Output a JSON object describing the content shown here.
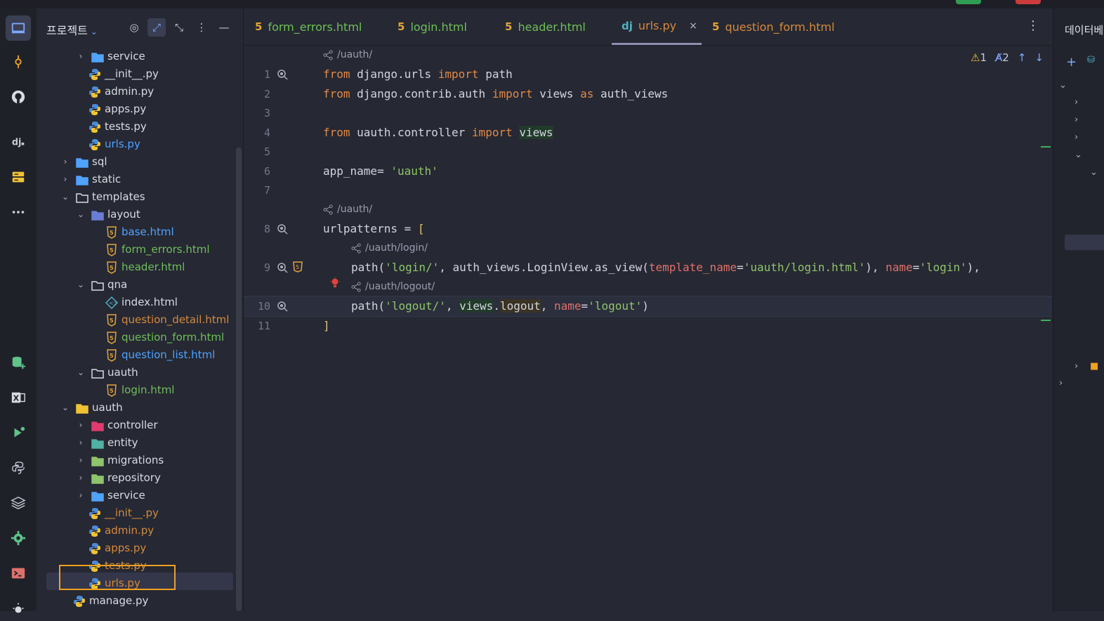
{
  "colors": {
    "accent": "#7ea9ff",
    "highlight": "#f1a020",
    "html_icon": "#e3a43a",
    "python_blue": "#4b8bd6",
    "python_yellow": "#f1c232"
  },
  "project_panel": {
    "title": "프로젝트",
    "tree": [
      {
        "label": "service",
        "type": "folder-service",
        "color": "white",
        "arrow": "›"
      },
      {
        "label": "__init__.py",
        "type": "py",
        "color": "white"
      },
      {
        "label": "admin.py",
        "type": "py",
        "color": "white"
      },
      {
        "label": "apps.py",
        "type": "py",
        "color": "white"
      },
      {
        "label": "tests.py",
        "type": "py",
        "color": "white"
      },
      {
        "label": "urls.py",
        "type": "py",
        "color": "blue"
      },
      {
        "label": "sql",
        "type": "folder-sql",
        "color": "white",
        "arrow": "›"
      },
      {
        "label": "static",
        "type": "folder-web",
        "color": "white",
        "arrow": "›"
      },
      {
        "label": "templates",
        "type": "folder-tpl",
        "color": "white",
        "arrow": "⌄"
      },
      {
        "label": "layout",
        "type": "folder-layout",
        "color": "white",
        "arrow": "⌄"
      },
      {
        "label": "base.html",
        "type": "html",
        "color": "blue"
      },
      {
        "label": "form_errors.html",
        "type": "html",
        "color": "green"
      },
      {
        "label": "header.html",
        "type": "html",
        "color": "green"
      },
      {
        "label": "qna",
        "type": "folder",
        "color": "white",
        "arrow": "⌄"
      },
      {
        "label": "index.html",
        "type": "html-alt",
        "color": "white"
      },
      {
        "label": "question_detail.html",
        "type": "html",
        "color": "orange"
      },
      {
        "label": "question_form.html",
        "type": "html",
        "color": "green"
      },
      {
        "label": "question_list.html",
        "type": "html",
        "color": "blue"
      },
      {
        "label": "uauth",
        "type": "folder",
        "color": "white",
        "arrow": "⌄"
      },
      {
        "label": "login.html",
        "type": "html",
        "color": "green"
      },
      {
        "label": "uauth",
        "type": "folder-yellow",
        "color": "white",
        "arrow": "⌄"
      },
      {
        "label": "controller",
        "type": "folder-controller",
        "color": "white",
        "arrow": "›"
      },
      {
        "label": "entity",
        "type": "folder-entity",
        "color": "white",
        "arrow": "›"
      },
      {
        "label": "migrations",
        "type": "folder-migrations",
        "color": "white",
        "arrow": "›"
      },
      {
        "label": "repository",
        "type": "folder-repository",
        "color": "white",
        "arrow": "›"
      },
      {
        "label": "service",
        "type": "folder-service",
        "color": "white",
        "arrow": "›"
      },
      {
        "label": "__init__.py",
        "type": "py",
        "color": "orange"
      },
      {
        "label": "admin.py",
        "type": "py",
        "color": "orange"
      },
      {
        "label": "apps.py",
        "type": "py",
        "color": "orange"
      },
      {
        "label": "tests.py",
        "type": "py",
        "color": "orange"
      },
      {
        "label": "urls.py",
        "type": "py",
        "color": "orange"
      },
      {
        "label": "manage.py",
        "type": "py",
        "color": "white"
      }
    ]
  },
  "tabs": [
    {
      "label": "form_errors.html",
      "icon": "html",
      "color": "green"
    },
    {
      "label": "login.html",
      "icon": "html",
      "color": "green"
    },
    {
      "label": "header.html",
      "icon": "html",
      "color": "green"
    },
    {
      "label": "urls.py",
      "icon": "dj",
      "color": "orange",
      "active": true,
      "close": "×"
    },
    {
      "label": "question_form.html",
      "icon": "html",
      "color": "orange"
    }
  ],
  "editor": {
    "status": {
      "warnings": "1",
      "typos": "2"
    },
    "route_hints": [
      "/uauth/",
      "/uauth/",
      "/uauth/login/",
      "/uauth/logout/"
    ],
    "line_numbers": [
      "1",
      "2",
      "3",
      "4",
      "5",
      "6",
      "7",
      "8",
      "9",
      "10",
      "11"
    ],
    "lines": {
      "l1": {
        "kw1": "from",
        "mod": " django.urls ",
        "kw2": "import",
        "name": " path"
      },
      "l2": {
        "kw1": "from",
        "mod": " django.contrib.auth ",
        "kw2": "import",
        "name": " views ",
        "kw3": "as",
        "name2": " auth_views"
      },
      "l4": {
        "kw1": "from",
        "mod": " uauth.controller ",
        "kw2": "import",
        "name": "views"
      },
      "l6": {
        "name": "app_name= ",
        "str": "'uauth'"
      },
      "l8": {
        "name": "urlpatterns = ",
        "br": "["
      },
      "l9": {
        "p1": "path(",
        "s1": "'login/'",
        "p2": ", auth_views.LoginView.as_view(",
        "par1": "template_name",
        "eq": "=",
        "s2": "'uauth/login.html'",
        "p3": "), ",
        "par2": "name",
        "eq2": "=",
        "s3": "'login'",
        "p4": "),"
      },
      "l10": {
        "p1": "path(",
        "s1": "'logout/'",
        "p2": ", ",
        "v": "views",
        "dot": ".",
        "lo": "logout",
        "p3": ", ",
        "par": "name",
        "eq": "=",
        "s2": "'logout'",
        "p4": ")"
      },
      "l11": {
        "br": "]"
      }
    }
  },
  "db_panel": {
    "title": "데이터베"
  }
}
